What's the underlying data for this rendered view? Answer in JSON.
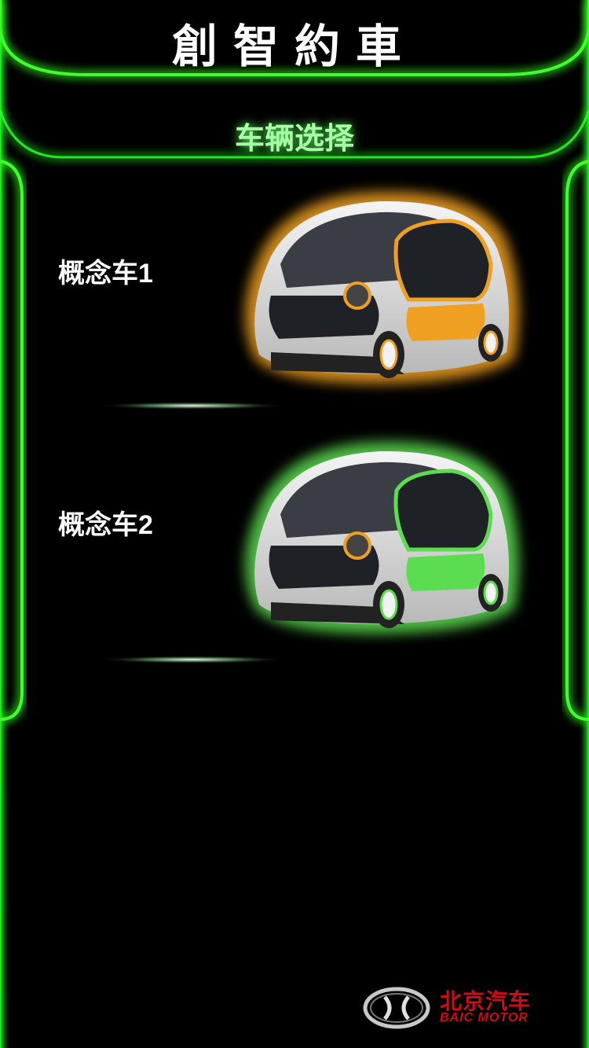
{
  "header": {
    "title": "創智約車"
  },
  "section": {
    "title": "车辆选择"
  },
  "cars": [
    {
      "label": "概念车1",
      "accent": "#f0a020"
    },
    {
      "label": "概念车2",
      "accent": "#5cdc50"
    }
  ],
  "brand": {
    "cn": "北京汽车",
    "en": "BAIC MOTOR",
    "color": "#d10a13"
  },
  "colors": {
    "glow": "#3cff2c",
    "background": "#000000"
  }
}
